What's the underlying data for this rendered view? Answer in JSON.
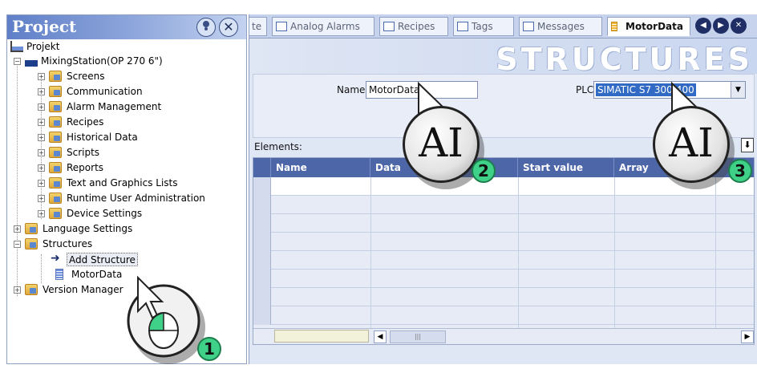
{
  "left_panel": {
    "title": "Project",
    "tree": [
      {
        "label": "Projekt"
      },
      {
        "label": "MixingStation(OP 270 6\")"
      },
      {
        "label": "Screens"
      },
      {
        "label": "Communication"
      },
      {
        "label": "Alarm Management"
      },
      {
        "label": "Recipes"
      },
      {
        "label": "Historical Data"
      },
      {
        "label": "Scripts"
      },
      {
        "label": "Reports"
      },
      {
        "label": "Text and Graphics Lists"
      },
      {
        "label": "Runtime User Administration"
      },
      {
        "label": "Device Settings"
      },
      {
        "label": "Language Settings"
      },
      {
        "label": "Structures"
      },
      {
        "label": "Add Structure"
      },
      {
        "label": "MotorData"
      },
      {
        "label": "Version Manager"
      }
    ]
  },
  "tabs": [
    {
      "label": "te"
    },
    {
      "label": "Analog Alarms"
    },
    {
      "label": "Recipes"
    },
    {
      "label": "Tags"
    },
    {
      "label": "Messages"
    },
    {
      "label": "MotorData",
      "active": true
    }
  ],
  "editor": {
    "heading": "STRUCTURES",
    "name_label": "Name",
    "name_value": "MotorData",
    "plc_label": "PLC",
    "plc_value": "SIMATIC S7 300/400",
    "elements_label": "Elements:",
    "columns": [
      "Name",
      "Data",
      "Start value",
      "Array"
    ]
  },
  "callouts": [
    {
      "number": "1",
      "icon": "mouse-click-icon"
    },
    {
      "number": "2",
      "text": "AI",
      "icon": "text-cursor-icon"
    },
    {
      "number": "3",
      "text": "AI",
      "icon": "text-cursor-icon"
    }
  ],
  "colors": {
    "accent_green": "#3fd188",
    "header_blue": "#4d66a8",
    "selection_blue": "#316ac5"
  }
}
